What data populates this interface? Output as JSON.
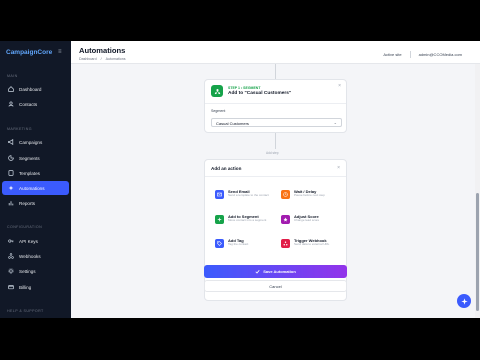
{
  "sidebar": {
    "brand": "CampaignCore",
    "sections": {
      "main": "MAIN",
      "marketing": "MARKETING",
      "configuration": "CONFIGURATION",
      "help": "HELP & SUPPORT"
    },
    "items": [
      {
        "label": "Dashboard",
        "icon": "home-icon"
      },
      {
        "label": "Contacts",
        "icon": "users-icon"
      },
      {
        "label": "Campaigns",
        "icon": "megaphone-icon"
      },
      {
        "label": "Segments",
        "icon": "segment-icon"
      },
      {
        "label": "Templates",
        "icon": "template-icon"
      },
      {
        "label": "Automations",
        "icon": "automation-icon",
        "active": true
      },
      {
        "label": "Reports",
        "icon": "chart-icon"
      },
      {
        "label": "API Keys",
        "icon": "key-icon"
      },
      {
        "label": "Webhooks",
        "icon": "webhook-icon"
      },
      {
        "label": "Settings",
        "icon": "gear-icon"
      },
      {
        "label": "Billing",
        "icon": "card-icon"
      }
    ]
  },
  "header": {
    "title": "Automations",
    "breadcrumb": [
      "Dashboard",
      "/",
      "Automations"
    ],
    "status": "Active site",
    "email": "admin@CCOMedia.com"
  },
  "trigger": {
    "step": "STEP 1 • SEGMENT",
    "title": "Add to \"Casual Customers\"",
    "segment_label": "Segment",
    "segment_value": "Casual Customers"
  },
  "add_step_label": "Add step",
  "actions": {
    "title": "Add an action",
    "items": [
      {
        "name": "Send Email",
        "desc": "Send a template to the contact",
        "icon": "mail-icon",
        "color": "#3b5bfd"
      },
      {
        "name": "Wait / Delay",
        "desc": "Pause before next step",
        "icon": "clock-icon",
        "color": "#f97316"
      },
      {
        "name": "Add to Segment",
        "desc": "Move contact into a segment",
        "icon": "segment-add-icon",
        "color": "#16a34a"
      },
      {
        "name": "Adjust Score",
        "desc": "Change lead score",
        "icon": "score-icon",
        "color": "#a21caf"
      },
      {
        "name": "Add Tag",
        "desc": "Tag the contact",
        "icon": "tag-icon",
        "color": "#3b5bfd"
      },
      {
        "name": "Trigger Webhook",
        "desc": "Send data to external URL",
        "icon": "webhook-icon",
        "color": "#e11d48"
      }
    ]
  },
  "buttons": {
    "save": "Save Automation",
    "cancel": "Cancel"
  },
  "colors": {
    "accent": "#3b5bfd",
    "accent_end": "#9333ea",
    "sidebar_bg": "#111827",
    "success": "#16a34a"
  }
}
